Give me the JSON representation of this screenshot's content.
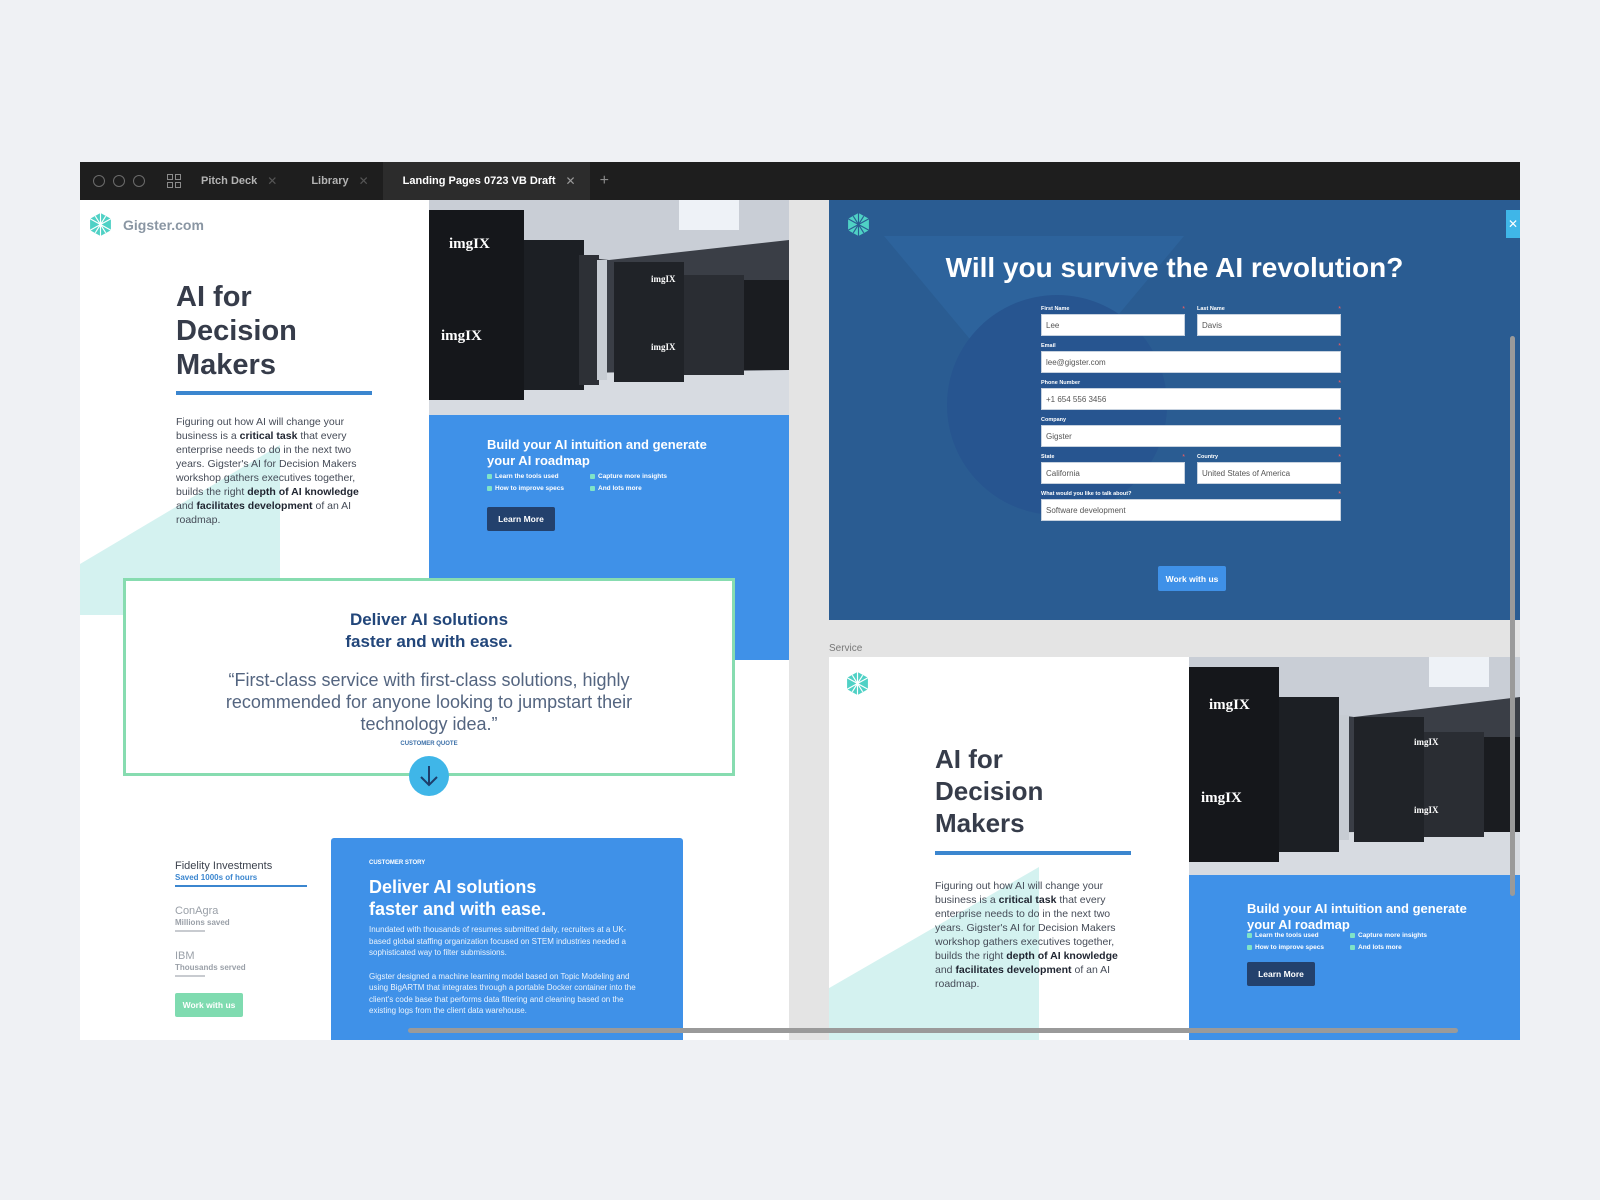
{
  "tabs": [
    {
      "label": "Pitch Deck",
      "active": false
    },
    {
      "label": "Library",
      "active": false
    },
    {
      "label": "Landing Pages 0723 VB Draft",
      "active": true
    }
  ],
  "icons": {
    "grid": "grid-icon",
    "close": "close-icon",
    "add": "plus-icon",
    "logo": "gigster-logo",
    "arrow": "arrow-down-icon"
  },
  "colors": {
    "accent_blue": "#3f91e8",
    "navy": "#2a5c92",
    "mint": "#87dcb0",
    "teal": "#3fb6e8"
  },
  "hero": {
    "brand": "Gigster.com",
    "title_lines": [
      "AI for",
      "Decision",
      "Makers"
    ],
    "body_parts": [
      "Figuring out how AI will change your business is a ",
      "critical task",
      " that every enterprise needs to do in the next two years. Gigster's AI for Decision Makers workshop gathers executives together, builds the right ",
      "depth of AI knowledge",
      " and ",
      "facilitates development",
      " of an AI roadmap."
    ],
    "photo_brand": "imgIX"
  },
  "roadmap": {
    "title": "Build your AI intuition and generate your AI roadmap",
    "bullets": [
      "Learn the tools used",
      "Capture more insights",
      "How to improve specs",
      "And lots more"
    ],
    "button": "Learn More"
  },
  "quote": {
    "title_line1": "Deliver AI solutions",
    "title_line2": "faster and with ease.",
    "text": "“First-class service with first-class solutions, highly recommended for anyone looking to jumpstart their technology idea.”",
    "caption": "CUSTOMER QUOTE"
  },
  "stats": [
    {
      "name": "Fidelity Investments",
      "sub": "Saved 1000s of hours"
    },
    {
      "name": "ConAgra",
      "sub": "Millions saved"
    },
    {
      "name": "IBM",
      "sub": "Thousands served"
    }
  ],
  "stats_button": "Work with us",
  "story": {
    "caption": "CUSTOMER STORY",
    "title_line1": "Deliver AI solutions",
    "title_line2": "faster and with ease.",
    "p1": "Inundated with thousands of resumes submitted daily, recruiters at a UK-based global staffing organization focused on STEM industries needed a sophisticated way to filter submissions.",
    "p2": "Gigster designed a machine learning model based on Topic Modeling and using BigARTM that integrates through a portable Docker container into the client's code base that performs data filtering and cleaning based on the existing logs from the client data warehouse."
  },
  "form": {
    "title": "Will you survive the AI revolution?",
    "first_name_label": "First Name",
    "first_name": "Lee",
    "last_name_label": "Last Name",
    "last_name": "Davis",
    "email_label": "Email",
    "email": "lee@gigster.com",
    "phone_label": "Phone Number",
    "phone": "+1 654 556 3456",
    "company_label": "Company",
    "company": "Gigster",
    "state_label": "State",
    "state": "California",
    "country_label": "Country",
    "country": "United States of America",
    "topic_label": "What would you like to talk about?",
    "topic": "Software development",
    "required_mark": "*",
    "submit": "Work with us"
  },
  "service_label": "Service"
}
